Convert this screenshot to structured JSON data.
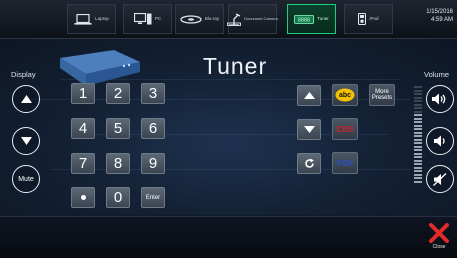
{
  "sources": [
    {
      "label": "Laptop",
      "icon": "laptop-icon"
    },
    {
      "label": "PC",
      "icon": "pc-icon"
    },
    {
      "label": "Blu-ray",
      "icon": "bluray-icon"
    },
    {
      "label": "Document Camera",
      "icon": "document-camera-icon"
    },
    {
      "label": "Tuner",
      "icon": "tuner-icon",
      "active": true
    },
    {
      "label": "iPod",
      "icon": "ipod-icon"
    }
  ],
  "datetime": {
    "date": "1/15/2016",
    "time": "4:59 AM"
  },
  "display": {
    "title": "Display",
    "mute_label": "Mute"
  },
  "volume": {
    "title": "Volume",
    "level_fraction": 0.72
  },
  "page_title": "Tuner",
  "keypad": {
    "keys": [
      "1",
      "2",
      "3",
      "4",
      "5",
      "6",
      "7",
      "8",
      "9",
      "•",
      "0",
      "Enter"
    ]
  },
  "presets": {
    "more_label_line1": "More",
    "more_label_line2": "Presets",
    "channels": [
      "abc",
      "CBS",
      "FOX"
    ]
  },
  "close_label": "Close",
  "colors": {
    "active_tab": "#1ccf7d",
    "abc_logo": "#f2c200",
    "cbs_logo": "#d0202a",
    "fox_logo": "#2a4fc6",
    "close_x": "#e12a2a"
  }
}
